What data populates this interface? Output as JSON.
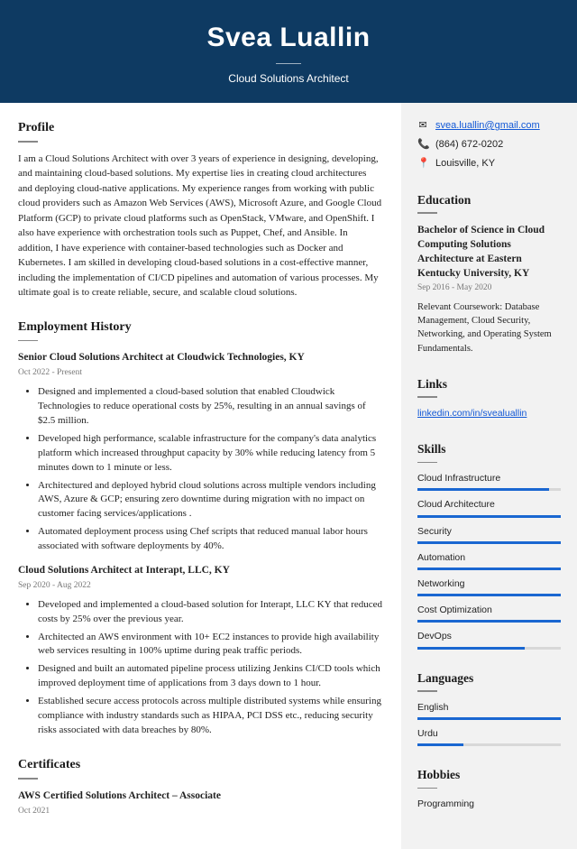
{
  "header": {
    "name": "Svea Luallin",
    "role": "Cloud Solutions Architect"
  },
  "profile": {
    "heading": "Profile",
    "text": "I am a Cloud Solutions Architect with over 3 years of experience in designing, developing, and maintaining cloud-based solutions. My expertise lies in creating cloud architectures and deploying cloud-native applications. My experience ranges from working with public cloud providers such as Amazon Web Services (AWS), Microsoft Azure, and Google Cloud Platform (GCP) to private cloud platforms such as OpenStack, VMware, and OpenShift. I also have experience with orchestration tools such as Puppet, Chef, and Ansible. In addition, I have experience with container-based technologies such as Docker and Kubernetes. I am skilled in developing cloud-based solutions in a cost-effective manner, including the implementation of CI/CD pipelines and automation of various processes. My ultimate goal is to create reliable, secure, and scalable cloud solutions."
  },
  "employment": {
    "heading": "Employment History",
    "jobs": [
      {
        "title": "Senior Cloud Solutions Architect at Cloudwick Technologies, KY",
        "dates": "Oct 2022 - Present",
        "bullets": [
          "Designed and implemented a cloud-based solution that enabled Cloudwick Technologies to reduce operational costs by 25%, resulting in an annual savings of $2.5 million.",
          "Developed high performance, scalable infrastructure for the company's data analytics platform which increased throughput capacity by 30% while reducing latency from 5 minutes down to 1 minute or less.",
          "Architectured and deployed hybrid cloud solutions across multiple vendors including AWS, Azure & GCP; ensuring zero downtime during migration with no impact on customer facing services/applications .",
          "Automated deployment process using Chef scripts that reduced manual labor hours associated with software deployments by 40%."
        ]
      },
      {
        "title": "Cloud Solutions Architect at Interapt, LLC, KY",
        "dates": "Sep 2020 - Aug 2022",
        "bullets": [
          "Developed and implemented a cloud-based solution for Interapt, LLC KY that reduced costs by 25% over the previous year.",
          "Architected an AWS environment with 10+ EC2 instances to provide high availability web services resulting in 100% uptime during peak traffic periods.",
          "Designed and built an automated pipeline process utilizing Jenkins CI/CD tools which improved deployment time of applications from 3 days down to 1 hour.",
          "Established secure access protocols across multiple distributed systems while ensuring compliance with industry standards such as HIPAA, PCI DSS etc., reducing security risks associated with data breaches by 80%."
        ]
      }
    ]
  },
  "certificates": {
    "heading": "Certificates",
    "items": [
      {
        "title": "AWS Certified Solutions Architect – Associate",
        "dates": "Oct 2021"
      }
    ]
  },
  "contact": {
    "email": "svea.luallin@gmail.com",
    "phone": "(864) 672-0202",
    "location": "Louisville, KY"
  },
  "education": {
    "heading": "Education",
    "degree": "Bachelor of Science in Cloud Computing Solutions Architecture at Eastern Kentucky University, KY",
    "dates": "Sep 2016 - May 2020",
    "detail": "Relevant Coursework: Database Management, Cloud Security, Networking, and Operating System Fundamentals."
  },
  "links": {
    "heading": "Links",
    "items": [
      "linkedin.com/in/svealuallin"
    ]
  },
  "skills": {
    "heading": "Skills",
    "items": [
      {
        "name": "Cloud Infrastructure",
        "pct": 92
      },
      {
        "name": "Cloud Architecture",
        "pct": 100
      },
      {
        "name": "Security",
        "pct": 100
      },
      {
        "name": "Automation",
        "pct": 100
      },
      {
        "name": "Networking",
        "pct": 100
      },
      {
        "name": "Cost Optimization",
        "pct": 100
      },
      {
        "name": "DevOps",
        "pct": 75
      }
    ]
  },
  "languages": {
    "heading": "Languages",
    "items": [
      {
        "name": "English",
        "pct": 100
      },
      {
        "name": "Urdu",
        "pct": 32
      }
    ]
  },
  "hobbies": {
    "heading": "Hobbies",
    "items": [
      "Programming"
    ]
  }
}
